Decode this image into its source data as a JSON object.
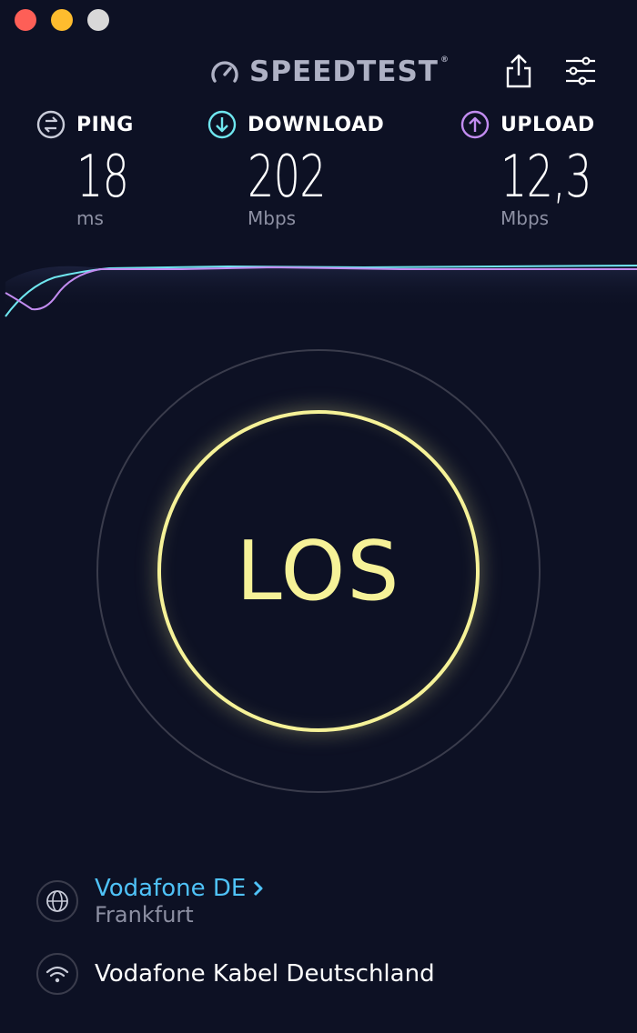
{
  "window": {
    "controls": [
      "close",
      "minimize",
      "maximize"
    ]
  },
  "header": {
    "brand": "SPEEDTEST",
    "brand_mark": "®",
    "icons": [
      "speedometer-icon",
      "share-icon",
      "settings-sliders-icon"
    ]
  },
  "metrics": {
    "ping": {
      "label": "PING",
      "value": "18",
      "unit": "ms",
      "color": "#c9ccd9"
    },
    "download": {
      "label": "DOWNLOAD",
      "value": "202",
      "unit": "Mbps",
      "color": "#6fe6ef"
    },
    "upload": {
      "label": "UPLOAD",
      "value": "12,3",
      "unit": "Mbps",
      "color": "#c28cf0"
    }
  },
  "go_button": {
    "label": "LOS",
    "color": "#f6f298"
  },
  "server": {
    "name": "Vodafone DE",
    "city": "Frankfurt",
    "link_color": "#4fc2f7"
  },
  "provider": {
    "name": "Vodafone Kabel Deutschland"
  },
  "colors": {
    "background": "#0d1124",
    "muted": "#8d90a3"
  }
}
